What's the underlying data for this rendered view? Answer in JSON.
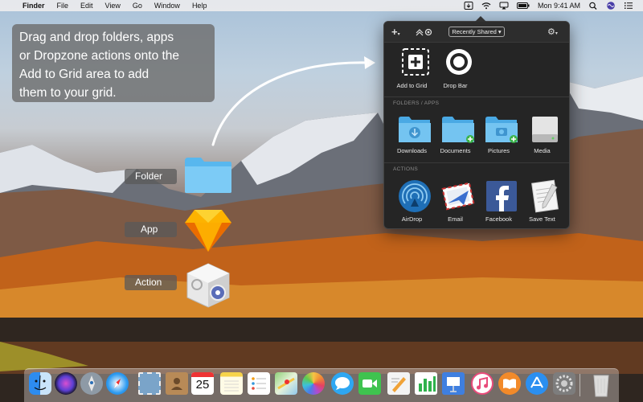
{
  "menubar": {
    "apple_glyph": "",
    "app_name": "Finder",
    "menus": [
      "File",
      "Edit",
      "View",
      "Go",
      "Window",
      "Help"
    ],
    "clock": "Mon 9:41 AM"
  },
  "instruction": {
    "lines": [
      "Drag and drop folders, apps",
      "or Dropzone actions onto the",
      "Add to Grid area to add",
      "them to your grid."
    ]
  },
  "demo_labels": {
    "folder": "Folder",
    "app": "App",
    "action": "Action"
  },
  "panel": {
    "add_glyph": "+",
    "dropdown_label": "Recently Shared",
    "top_items": [
      {
        "label": "Add to Grid",
        "icon": "add-to-grid-icon"
      },
      {
        "label": "Drop Bar",
        "icon": "drop-bar-icon"
      }
    ],
    "folders_heading": "FOLDERS / APPS",
    "folders": [
      {
        "label": "Downloads",
        "icon": "downloads-folder-icon"
      },
      {
        "label": "Documents",
        "icon": "documents-folder-icon"
      },
      {
        "label": "Pictures",
        "icon": "pictures-folder-icon"
      },
      {
        "label": "Media",
        "icon": "media-drive-icon"
      }
    ],
    "actions_heading": "ACTIONS",
    "actions": [
      {
        "label": "AirDrop",
        "icon": "airdrop-icon"
      },
      {
        "label": "Email",
        "icon": "email-icon"
      },
      {
        "label": "Facebook",
        "icon": "facebook-icon"
      },
      {
        "label": "Save Text",
        "icon": "save-text-icon"
      }
    ]
  },
  "dock": {
    "calendar_day": "25",
    "apps": [
      "finder",
      "siri",
      "launchpad",
      "safari",
      "mail-stamp",
      "contacts",
      "calendar",
      "notes",
      "reminders",
      "maps",
      "photos",
      "messages",
      "facetime",
      "pages",
      "numbers",
      "keynote",
      "music",
      "books",
      "app-store",
      "system-preferences",
      "trash"
    ]
  }
}
